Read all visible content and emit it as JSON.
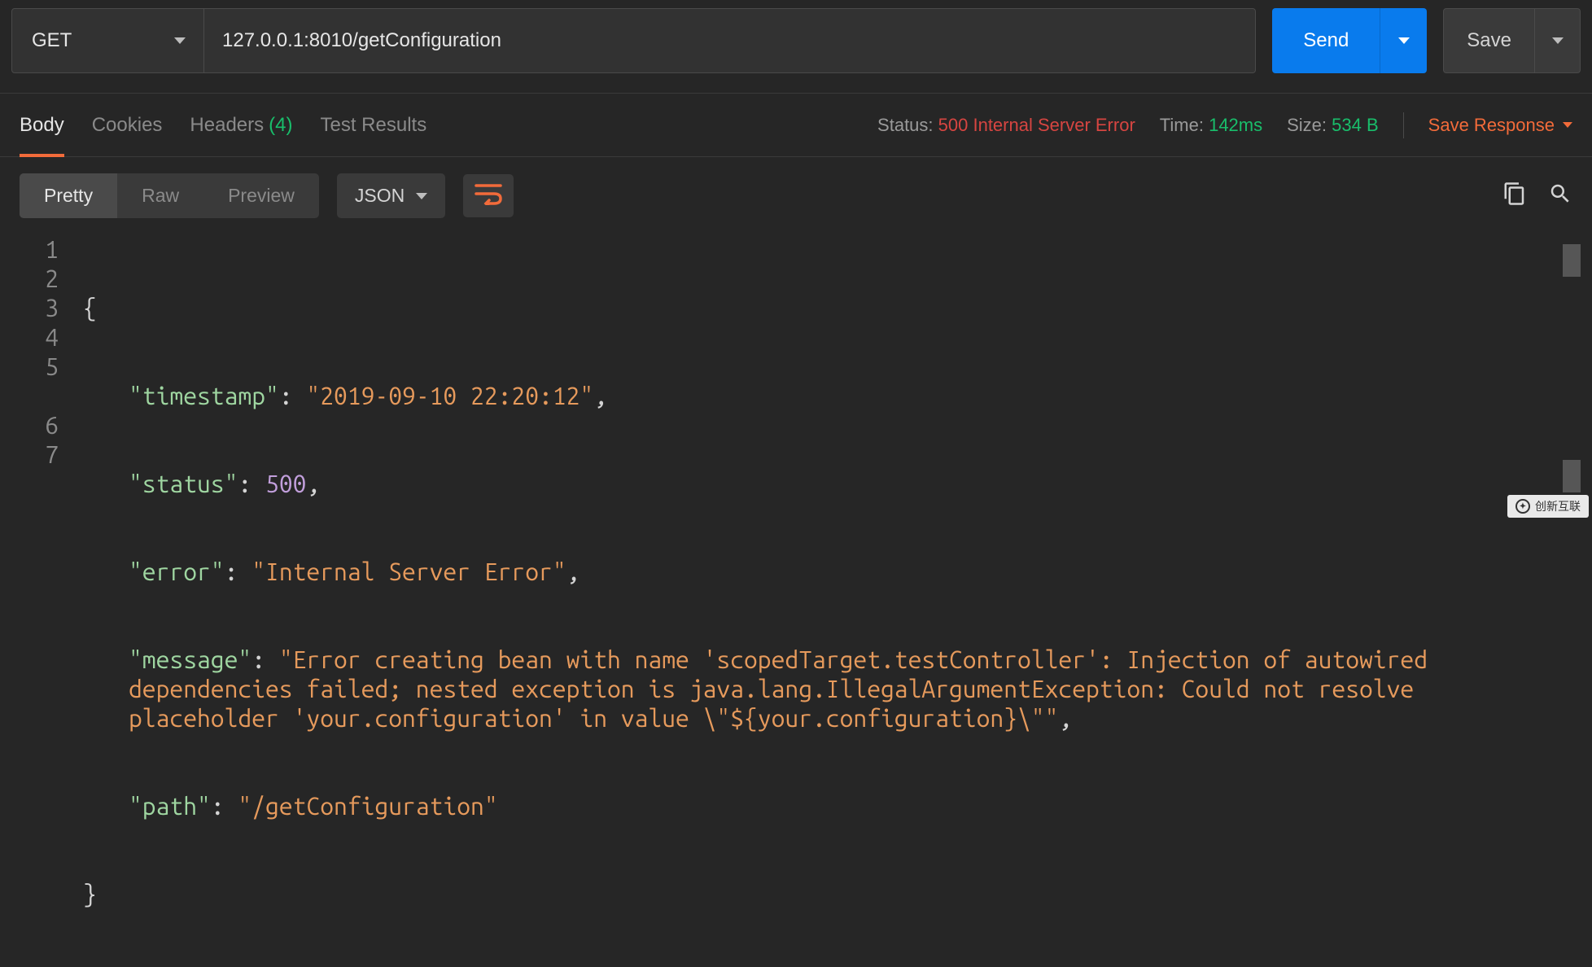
{
  "request": {
    "method": "GET",
    "url": "127.0.0.1:8010/getConfiguration",
    "send_label": "Send",
    "save_label": "Save"
  },
  "tabs": {
    "body": "Body",
    "cookies": "Cookies",
    "headers": "Headers",
    "headers_count": "(4)",
    "test_results": "Test Results"
  },
  "meta": {
    "status_label": "Status:",
    "status_value": "500 Internal Server Error",
    "time_label": "Time:",
    "time_value": "142ms",
    "size_label": "Size:",
    "size_value": "534 B",
    "save_response": "Save Response"
  },
  "view": {
    "pretty": "Pretty",
    "raw": "Raw",
    "preview": "Preview",
    "format": "JSON"
  },
  "code": {
    "line_numbers": [
      "1",
      "2",
      "3",
      "4",
      "5",
      "",
      "6",
      "7"
    ],
    "l1": "{",
    "l2_key": "\"timestamp\"",
    "l2_val": "\"2019-09-10 22:20:12\"",
    "l3_key": "\"status\"",
    "l3_val": "500",
    "l4_key": "\"error\"",
    "l4_val": "\"Internal Server Error\"",
    "l5_key": "\"message\"",
    "l5_val": "\"Error creating bean with name 'scopedTarget.testController': Injection of autowired dependencies failed; nested exception is java.lang.IllegalArgumentException: Could not resolve placeholder 'your.configuration' in value \\\"${your.configuration}\\\"\"",
    "l6_key": "\"path\"",
    "l6_val": "\"/getConfiguration\"",
    "l7": "}"
  },
  "watermark": "创新互联"
}
